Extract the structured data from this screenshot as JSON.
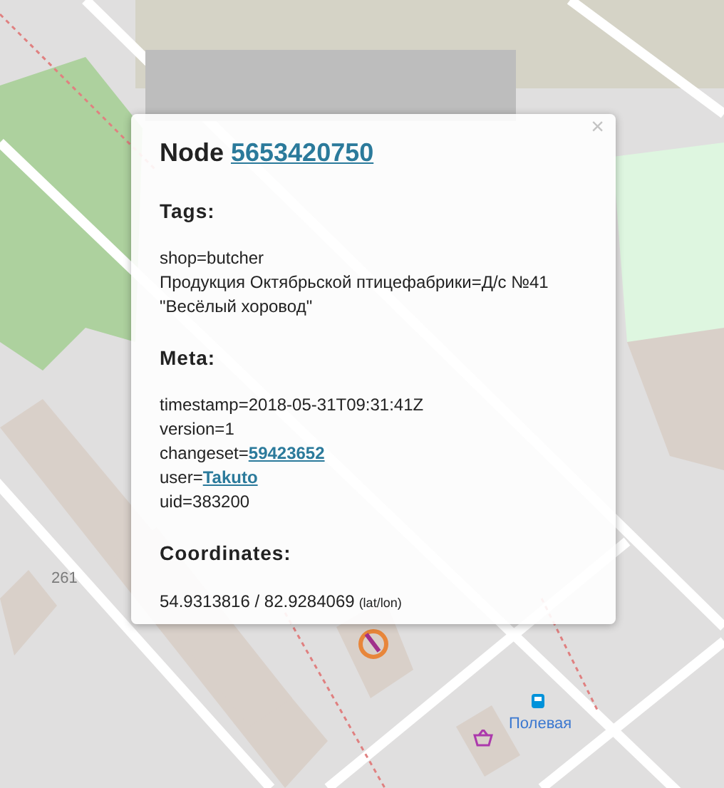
{
  "map": {
    "labels": [
      {
        "kind": "house_number",
        "text": "261"
      },
      {
        "kind": "bus_stop",
        "text": "Полевая"
      }
    ]
  },
  "popup": {
    "title": "Node",
    "id": "5653420750",
    "close": "×",
    "sections": [
      {
        "heading": "Tags:",
        "lines": [
          {
            "key": "shop=",
            "value": "butcher",
            "link": false
          },
          {
            "key": "Продукция Октябрьской птицефабрики=",
            "value": "Д/с №41 \"Весёлый хоровод\"",
            "link": false
          }
        ]
      },
      {
        "heading": "Meta:",
        "lines": [
          {
            "key": "timestamp=",
            "value": "2018-05-31T09:31:41Z",
            "link": false
          },
          {
            "key": "version=",
            "value": "1",
            "link": false
          },
          {
            "key": "changeset=",
            "value": "59423652",
            "link": true
          },
          {
            "key": "user=",
            "value": "Takuto",
            "link": true
          },
          {
            "key": "uid=",
            "value": "383200",
            "link": false
          }
        ]
      },
      {
        "heading": "Coordinates:",
        "coords": "54.9313816 / 82.9284069",
        "coords_note": "(lat/lon)"
      }
    ]
  }
}
